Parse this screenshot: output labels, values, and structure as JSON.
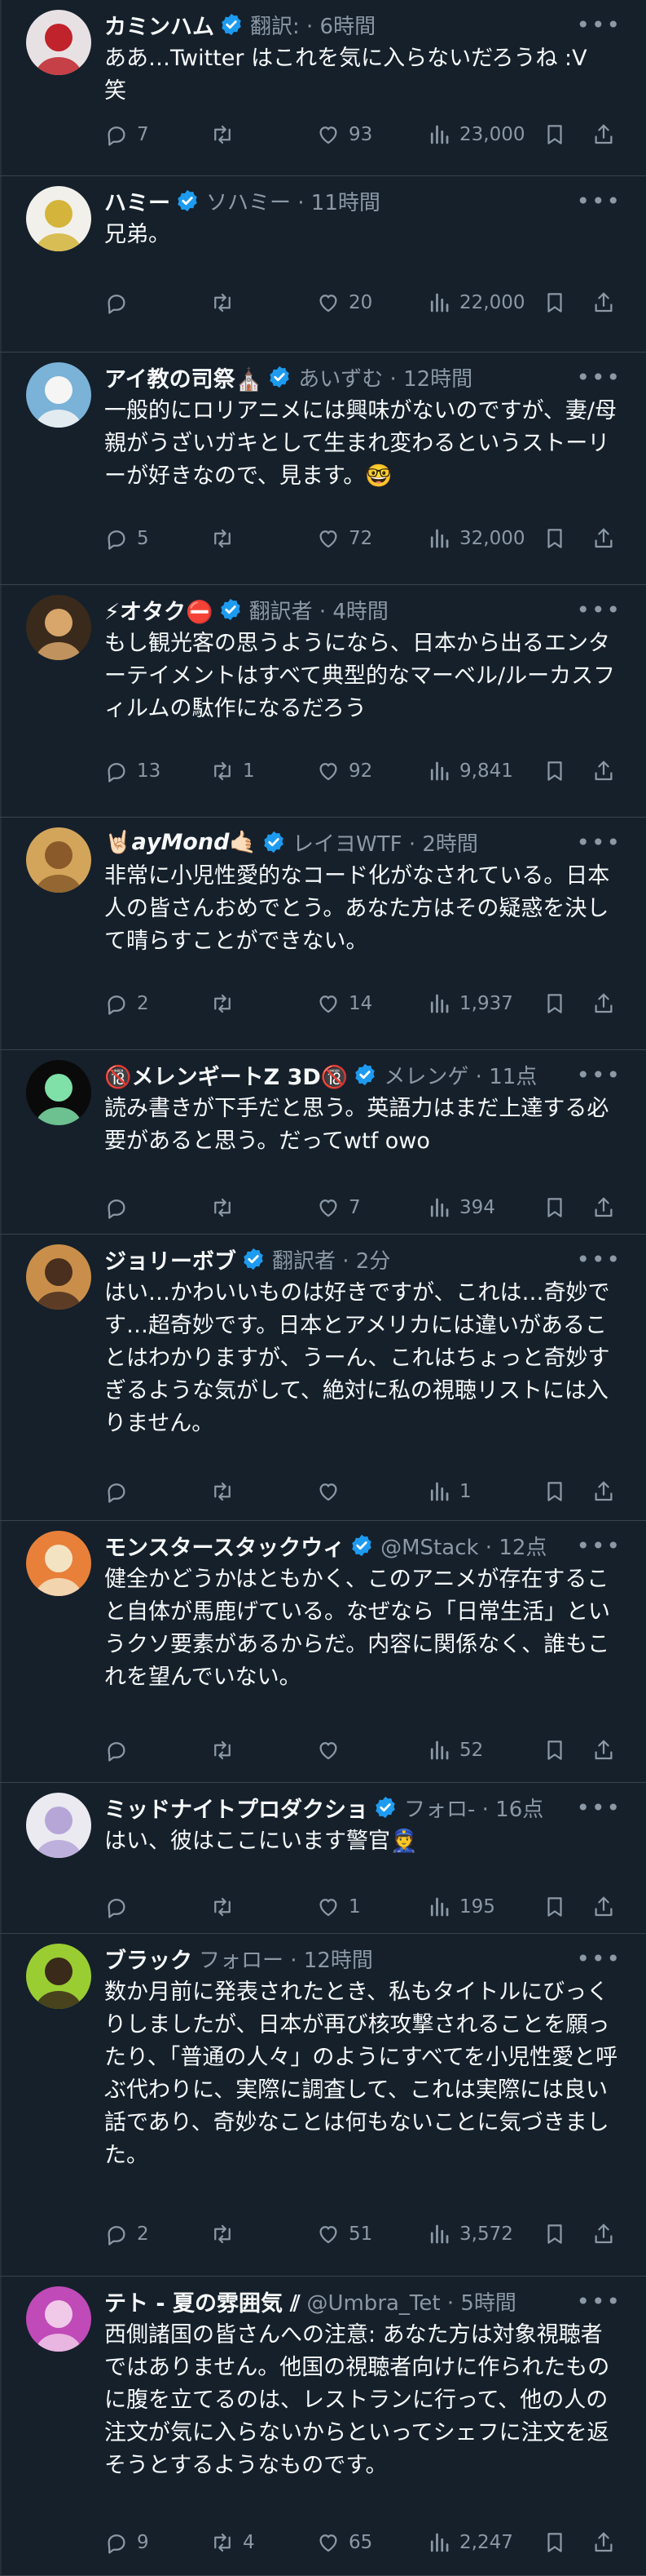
{
  "tweets": [
    {
      "name": "カミンハム",
      "meta": "翻訳: · 6時間",
      "verified": true,
      "text": "ああ…Twitter はこれを気に入らないだろうね :V\n笑",
      "replies": "7",
      "retweets": "",
      "likes": "93",
      "views": "23,000",
      "avatar": {
        "bg": "#e8e1e3",
        "fg": "#c0232b"
      }
    },
    {
      "name": "ハミー",
      "meta": "ソハミー · 11時間",
      "verified": true,
      "text": "兄弟。",
      "replies": "",
      "retweets": "",
      "likes": "20",
      "views": "22,000",
      "avatar": {
        "bg": "#f2f0ea",
        "fg": "#d4b43a"
      }
    },
    {
      "name": "アイ教の司祭⛪",
      "meta": "あいずむ · 12時間",
      "verified": true,
      "text": "一般的にロリアニメには興味がないのですが、妻/母親がうざいガキとして生まれ変わるというストーリーが好きなので、見ます。🤓",
      "replies": "5",
      "retweets": "",
      "likes": "72",
      "views": "32,000",
      "avatar": {
        "bg": "#7ab2d8",
        "fg": "#f5f5f5"
      }
    },
    {
      "name": "⚡オタク⛔",
      "meta": "翻訳者 · 4時間",
      "verified": true,
      "text": "もし観光客の思うようになら、日本から出るエンターテイメントはすべて典型的なマーベル/ルーカスフィルムの駄作になるだろう",
      "replies": "13",
      "retweets": "1",
      "likes": "92",
      "views": "9,841",
      "avatar": {
        "bg": "#3a2a1c",
        "fg": "#d8a66a"
      }
    },
    {
      "name": "🤘🏻𝙖𝙮𝙈𝙤𝙣𝙙🤙🏻",
      "meta": "レイヨWTF · 2時間",
      "verified": true,
      "text": "非常に小児性愛的なコード化がなされている。日本人の皆さんおめでとう。あなた方はその疑惑を決して晴らすことができない。",
      "replies": "2",
      "retweets": "",
      "likes": "14",
      "views": "1,937",
      "avatar": {
        "bg": "#d2a55a",
        "fg": "#8a5a2a"
      }
    },
    {
      "name": "🔞メレンギートZ 3D🔞",
      "meta": "メレンゲ · 11点",
      "verified": true,
      "text": "読み書きが下手だと思う。英語力はまだ上達する必要があると思う。だってwtf owo",
      "replies": "",
      "retweets": "",
      "likes": "7",
      "views": "394",
      "avatar": {
        "bg": "#0a0a0a",
        "fg": "#7fe0a8"
      }
    },
    {
      "name": "ジョリーボブ",
      "meta": "翻訳者 · 2分",
      "verified": true,
      "text": "はい…かわいいものは好きですが、これは…奇妙です…超奇妙です。日本とアメリカには違いがあることはわかりますが、うーん、これはちょっと奇妙すぎるような気がして、絶対に私の視聴リストには入りません。",
      "replies": "",
      "retweets": "",
      "likes": "",
      "views": "1",
      "avatar": {
        "bg": "#c98f4a",
        "fg": "#4a2e1e"
      }
    },
    {
      "name": "モンスタースタックウィ",
      "meta": "@MStack · 12点",
      "verified": true,
      "text": "健全かどうかはともかく、このアニメが存在すること自体が馬鹿げている。なぜなら「日常生活」というクソ要素があるからだ。内容に関係なく、誰もこれを望んでいない。",
      "replies": "",
      "retweets": "",
      "likes": "",
      "views": "52",
      "avatar": {
        "bg": "#e8803a",
        "fg": "#f3e3c3"
      }
    },
    {
      "name": "ミッドナイトプロダクショ",
      "meta": "フォロ- · 16点",
      "verified": true,
      "text": "はい、彼はここにいます警官👮",
      "replies": "",
      "retweets": "",
      "likes": "1",
      "views": "195",
      "avatar": {
        "bg": "#eaeaf0",
        "fg": "#b6a6d8"
      }
    },
    {
      "name": "ブラック",
      "meta": "フォロー · 12時間",
      "verified": false,
      "text": "数か月前に発表されたとき、私もタイトルにびっくりしましたが、日本が再び核攻撃されることを願ったり、「普通の人々」のようにすべてを小児性愛と呼ぶ代わりに、実際に調査して、これは実際には良い話であり、奇妙なことは何もないことに気づきました。",
      "replies": "2",
      "retweets": "",
      "likes": "51",
      "views": "3,572",
      "avatar": {
        "bg": "#9acd32",
        "fg": "#3a2a1a"
      }
    },
    {
      "name": "テト - 夏の雰囲気 ⫽",
      "meta": "@Umbra_Tet · 5時間",
      "verified": false,
      "text": "西側諸国の皆さんへの注意: あなた方は対象視聴者ではありません。他国の視聴者向けに作られたものに腹を立てるのは、レストランに行って、他の人の注文が気に入らないからといってシェフに注文を返そうとするようなものです。",
      "replies": "9",
      "retweets": "4",
      "likes": "65",
      "views": "2,247",
      "avatar": {
        "bg": "#c04ab8",
        "fg": "#f0c8e8"
      }
    }
  ],
  "colors": {
    "background": "#15202b",
    "border": "#38444d",
    "text": "#f7f9f9",
    "muted": "#8b98a5",
    "verified": "#1d9bf0"
  },
  "icons": [
    "reply-icon",
    "retweet-icon",
    "like-icon",
    "views-icon",
    "bookmark-icon",
    "share-icon",
    "verified-badge-icon",
    "more-icon"
  ]
}
